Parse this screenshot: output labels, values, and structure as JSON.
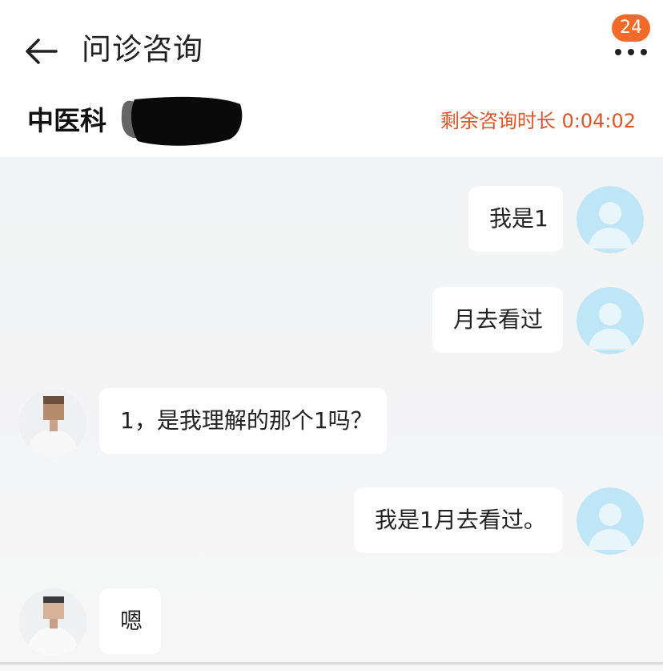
{
  "header": {
    "title": "问诊咨询",
    "department": "中医科",
    "remaining_time": "剩余咨询时长 0:04:02",
    "badge_count": "24",
    "back_icon": "arrow-left-icon",
    "more_icon": "more-dots-icon"
  },
  "colors": {
    "accent_orange": "#f06b2a",
    "timer_text": "#d9572a",
    "chat_background": "#f3f3f4",
    "bubble": "#ffffff",
    "user_avatar": "#bfe6f7"
  },
  "messages": [
    {
      "sender": "user",
      "text": "我是1"
    },
    {
      "sender": "user",
      "text": "月去看过"
    },
    {
      "sender": "doctor",
      "text": "1，是我理解的那个1吗？"
    },
    {
      "sender": "user",
      "text": "我是1月去看过。"
    },
    {
      "sender": "doctor",
      "text": "嗯"
    }
  ]
}
